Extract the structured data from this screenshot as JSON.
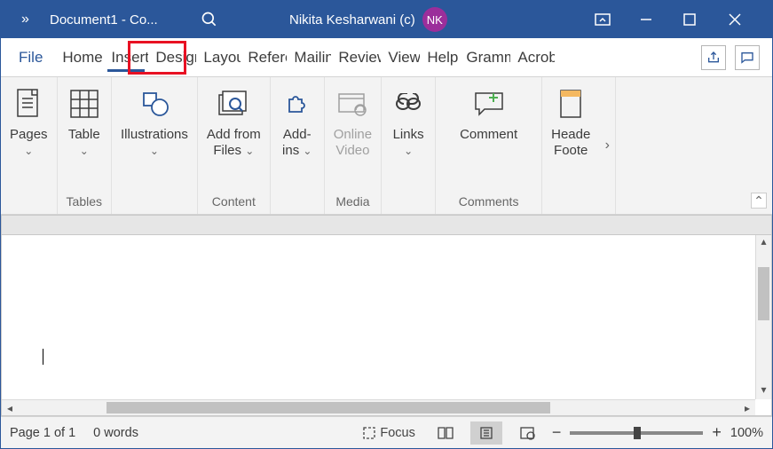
{
  "titlebar": {
    "overflow_label": "»",
    "document_title": "Document1  -  Co...",
    "user_name": "Nikita Kesharwani (c)",
    "avatar_initials": "NK"
  },
  "tabs": {
    "file": "File",
    "items": [
      "Home",
      "Insert",
      "Design",
      "Layou",
      "Refere",
      "Mailin",
      "Review",
      "View",
      "Help",
      "Gramm",
      "Acrob"
    ],
    "active_index": 1
  },
  "ribbon": {
    "pages": {
      "label": "Pages"
    },
    "table": {
      "label": "Table",
      "group": "Tables"
    },
    "illustrations": {
      "label": "Illustrations"
    },
    "add_from_files": {
      "label_line1": "Add from",
      "label_line2": "Files",
      "group": "Content"
    },
    "addins": {
      "label_line1": "Add-",
      "label_line2": "ins"
    },
    "online_video": {
      "label_line1": "Online",
      "label_line2": "Video",
      "group": "Media"
    },
    "links": {
      "label": "Links"
    },
    "comment": {
      "label": "Comment",
      "group": "Comments"
    },
    "header_footer": {
      "label_line1": "Heade",
      "label_line2": "Foote"
    }
  },
  "statusbar": {
    "page_info": "Page 1 of 1",
    "word_count": "0 words",
    "focus_label": "Focus",
    "zoom": "100%"
  }
}
